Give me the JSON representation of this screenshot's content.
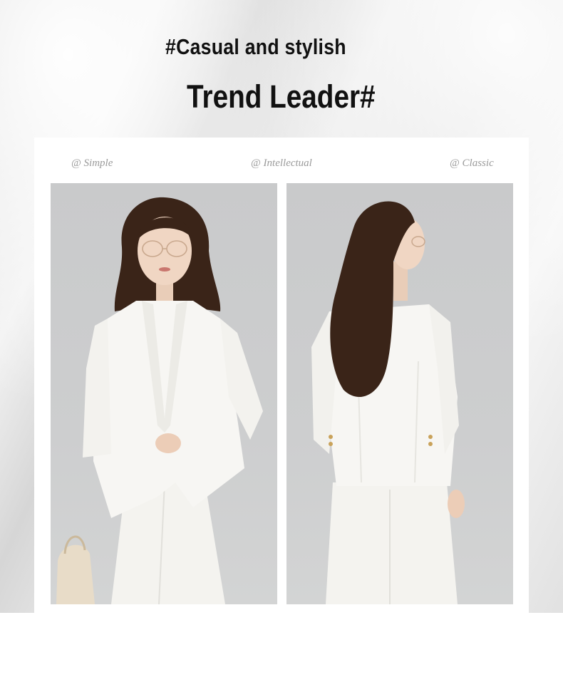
{
  "header": {
    "line1": "#Casual and stylish",
    "line2": "Trend Leader#"
  },
  "tags": [
    {
      "label": "@ Simple"
    },
    {
      "label": "@ Intellectual"
    },
    {
      "label": "@ Classic"
    }
  ],
  "photos": [
    {
      "name": "front-view"
    },
    {
      "name": "back-view"
    }
  ],
  "colors": {
    "text": "#111111",
    "tag": "#9a9a9a",
    "garment": "#f7f6f3",
    "backdrop": "#cbcccd",
    "hair": "#3a2418"
  }
}
